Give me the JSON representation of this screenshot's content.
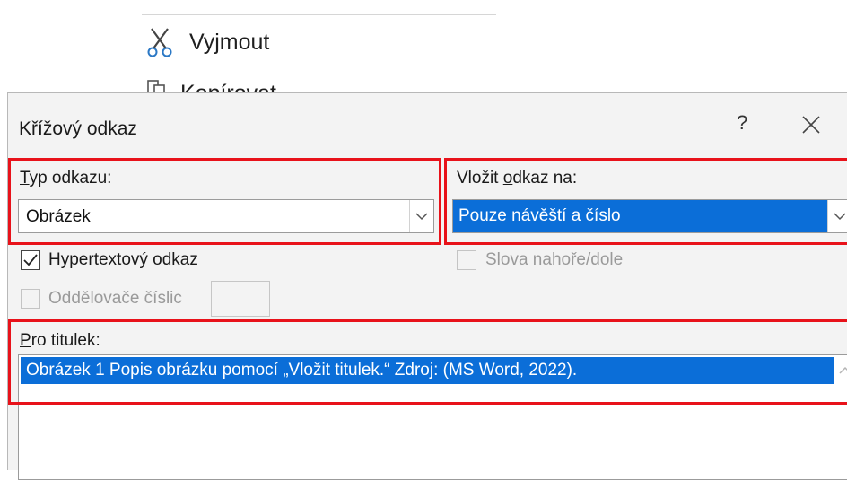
{
  "context_menu": {
    "cut_label": "Vyjmout",
    "copy_label": "Kopírovat"
  },
  "dialog": {
    "title": "Křížový odkaz",
    "help_label": "?",
    "reference_type": {
      "label": "Typ odkazu:",
      "selected": "Obrázek"
    },
    "insert_reference_to": {
      "label": "Vložit odkaz na:",
      "selected": "Pouze návěští a číslo"
    },
    "hyperlink": {
      "label": "Hypertextový odkaz",
      "checked": true
    },
    "above_below": {
      "label": "Slova nahoře/dole",
      "checked": false,
      "disabled": true
    },
    "number_separators": {
      "label": "Oddělovače číslic",
      "checked": false,
      "disabled": true
    },
    "for_caption": {
      "label": "Pro titulek:",
      "items": [
        "Obrázek 1 Popis obrázku pomocí „Vložit titulek.“ Zdroj: (MS Word, 2022)."
      ]
    }
  },
  "colors": {
    "highlight": "#0b6ed8",
    "annotation_red": "#e8121a",
    "dialog_bg": "#f3f3f3"
  }
}
